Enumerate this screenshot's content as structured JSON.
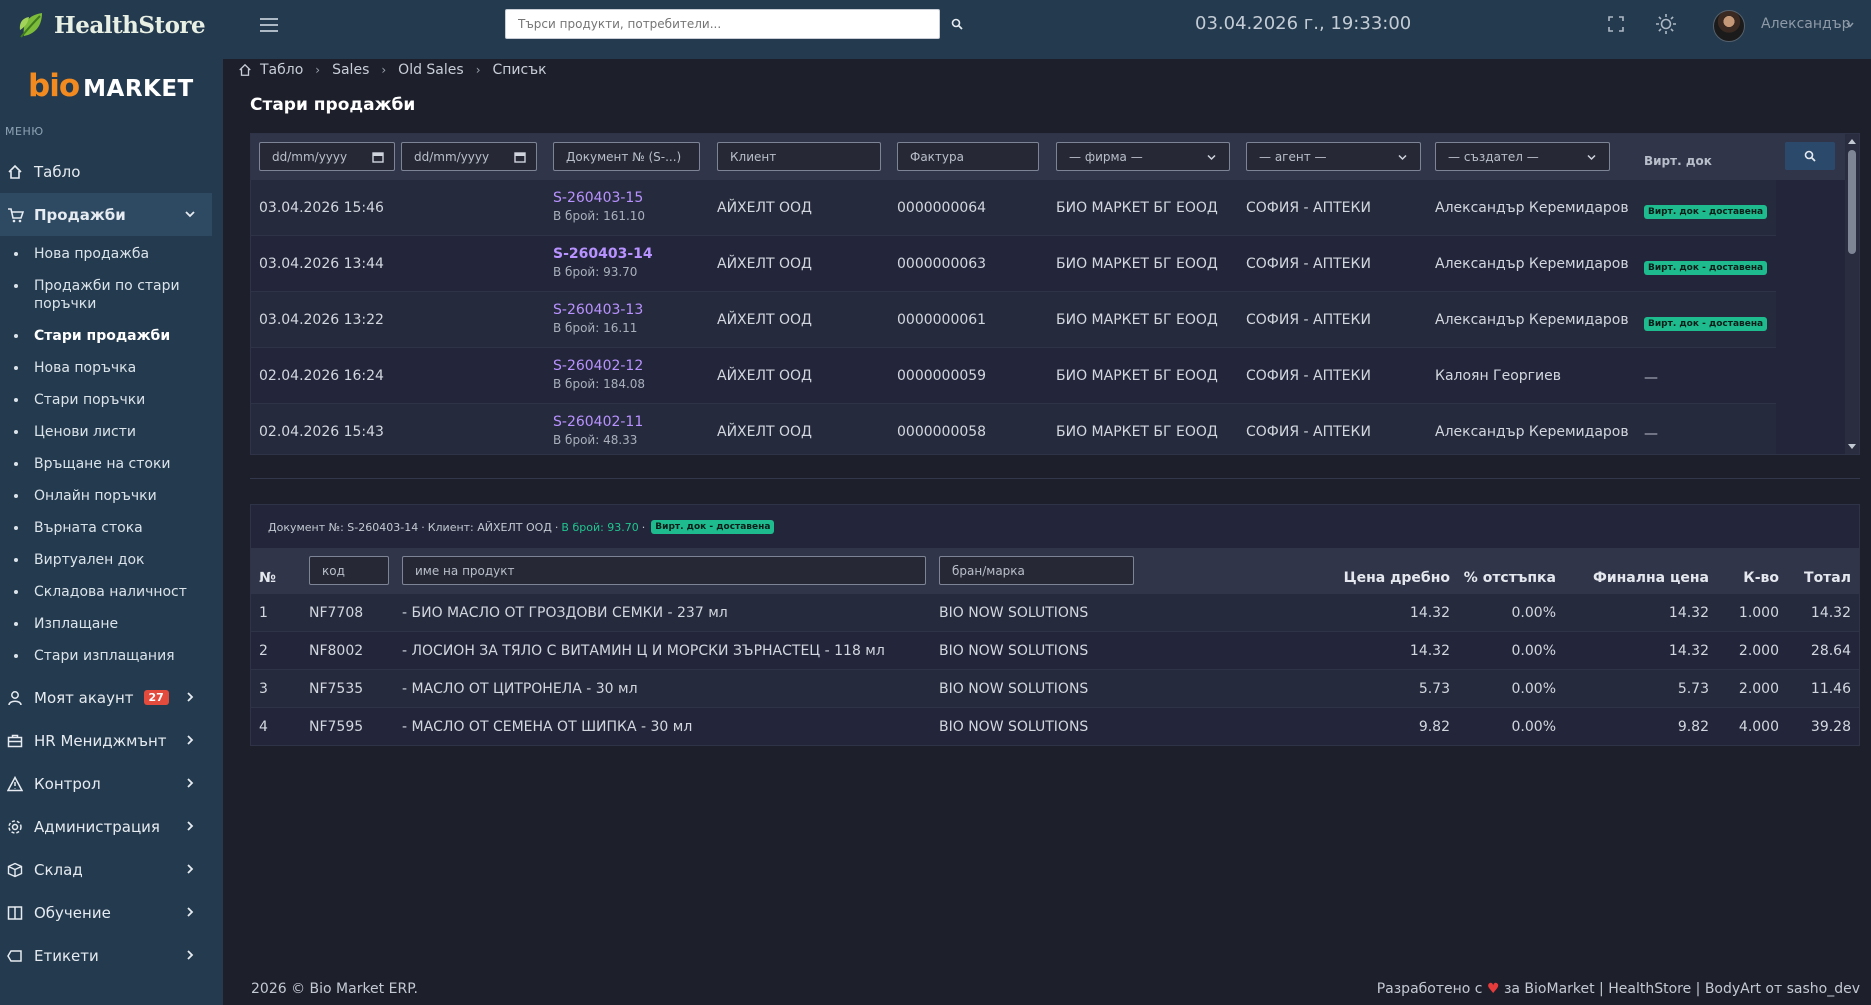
{
  "brand": {
    "healthstore": "HealthStore",
    "bio": "bio",
    "market": "MARKET",
    "menu_label": "МЕНЮ"
  },
  "topbar": {
    "search_placeholder": "Търси продукти, потребители...",
    "clock": "03.04.2026 г., 19:33:00",
    "user": "Александър"
  },
  "nav": {
    "dashboard": "Табло",
    "sales": "Продажби",
    "sales_sub": [
      "Нова продажба",
      "Продажби по стари поръчки",
      "Стари продажби",
      "Нова поръчка",
      "Стари поръчки",
      "Ценови листи",
      "Връщане на стоки",
      "Онлайн поръчки",
      "Върната стока",
      "Виртуален док",
      "Складова наличност",
      "Изплащане",
      "Стари изплащания"
    ],
    "account": "Моят акаунт",
    "account_badge": "27",
    "hr": "HR Мениджмънт",
    "control": "Контрол",
    "admin": "Администрация",
    "warehouse": "Склад",
    "training": "Обучение",
    "labels": "Етикети"
  },
  "breadcrumb": [
    "Табло",
    "Sales",
    "Old Sales",
    "Списък"
  ],
  "page_title": "Стари продажби",
  "filters": {
    "date_from": "dd/mm/yyyy",
    "date_to": "dd/mm/yyyy",
    "document": "Документ № (S-...)",
    "client": "Клиент",
    "invoice": "Фактура",
    "firm": "— фирма —",
    "agent": "— агент —",
    "creator": "— създател —",
    "virt_doc": "Вирт. док"
  },
  "sales": [
    {
      "date": "03.04.2026 15:46",
      "doc": "S-260403-15",
      "cash": "В брой: 161.10",
      "client": "АЙХЕЛТ ООД",
      "invoice": "0000000064",
      "firm": "БИО МАРКЕТ БГ ЕООД",
      "agent": "СОФИЯ - АПТЕКИ",
      "creator": "Александър Керемидаров",
      "virt": "Вирт. док - доставена"
    },
    {
      "date": "03.04.2026 13:44",
      "doc": "S-260403-14",
      "cash": "В брой: 93.70",
      "client": "АЙХЕЛТ ООД",
      "invoice": "0000000063",
      "firm": "БИО МАРКЕТ БГ ЕООД",
      "agent": "СОФИЯ - АПТЕКИ",
      "creator": "Александър Керемидаров",
      "virt": "Вирт. док - доставена"
    },
    {
      "date": "03.04.2026 13:22",
      "doc": "S-260403-13",
      "cash": "В брой: 16.11",
      "client": "АЙХЕЛТ ООД",
      "invoice": "0000000061",
      "firm": "БИО МАРКЕТ БГ ЕООД",
      "agent": "СОФИЯ - АПТЕКИ",
      "creator": "Александър Керемидаров",
      "virt": "Вирт. док - доставена"
    },
    {
      "date": "02.04.2026 16:24",
      "doc": "S-260402-12",
      "cash": "В брой: 184.08",
      "client": "АЙХЕЛТ ООД",
      "invoice": "0000000059",
      "firm": "БИО МАРКЕТ БГ ЕООД",
      "agent": "СОФИЯ - АПТЕКИ",
      "creator": "Калоян Георгиев",
      "virt": "—"
    },
    {
      "date": "02.04.2026 15:43",
      "doc": "S-260402-11",
      "cash": "В брой: 48.33",
      "client": "АЙХЕЛТ ООД",
      "invoice": "0000000058",
      "firm": "БИО МАРКЕТ БГ ЕООД",
      "agent": "СОФИЯ - АПТЕКИ",
      "creator": "Александър Керемидаров",
      "virt": "—"
    }
  ],
  "detail": {
    "doc_label": "Документ №: S-260403-14",
    "client_label": "Клиент: АЙХЕЛТ ООД",
    "cash_label": "В брой: 93.70",
    "virt": "Вирт. док - доставена",
    "sep": "·",
    "headers": {
      "no": "№",
      "code_ph": "код",
      "name_ph": "име на продукт",
      "brand_ph": "бран/марка",
      "retail": "Цена дребно",
      "discount": "% отстъпка",
      "final": "Финална цена",
      "qty": "К-во",
      "total": "Тотал"
    },
    "items": [
      {
        "no": "1",
        "code": "NF7708",
        "name": "- БИО МАСЛО ОТ ГРОЗДОВИ СЕМКИ - 237 мл",
        "brand": "BIO NOW SOLUTIONS",
        "retail": "14.32",
        "discount": "0.00%",
        "final": "14.32",
        "qty": "1.000",
        "total": "14.32"
      },
      {
        "no": "2",
        "code": "NF8002",
        "name": "- ЛОСИОН ЗА ТЯЛО С ВИТАМИН Ц И МОРСКИ ЗЪРНАСТЕЦ - 118 мл",
        "brand": "BIO NOW SOLUTIONS",
        "retail": "14.32",
        "discount": "0.00%",
        "final": "14.32",
        "qty": "2.000",
        "total": "28.64"
      },
      {
        "no": "3",
        "code": "NF7535",
        "name": "- МАСЛО ОТ ЦИТРОНЕЛА - 30 мл",
        "brand": "BIO NOW SOLUTIONS",
        "retail": "5.73",
        "discount": "0.00%",
        "final": "5.73",
        "qty": "2.000",
        "total": "11.46"
      },
      {
        "no": "4",
        "code": "NF7595",
        "name": "- МАСЛО ОТ СЕМЕНА ОТ ШИПКА - 30 мл",
        "brand": "BIO NOW SOLUTIONS",
        "retail": "9.82",
        "discount": "0.00%",
        "final": "9.82",
        "qty": "4.000",
        "total": "39.28"
      }
    ]
  },
  "footer": {
    "left": "2026 © Bio Market ERP.",
    "right_prefix": "Разработено с",
    "right_suffix": "за BioMarket | HealthStore | BodyArt от sasho_dev"
  },
  "colors": {
    "sidebar": "#243a4e",
    "accent_link": "#b892ff",
    "badge_green": "#1dbb8d",
    "badge_red": "#e34b3c"
  }
}
